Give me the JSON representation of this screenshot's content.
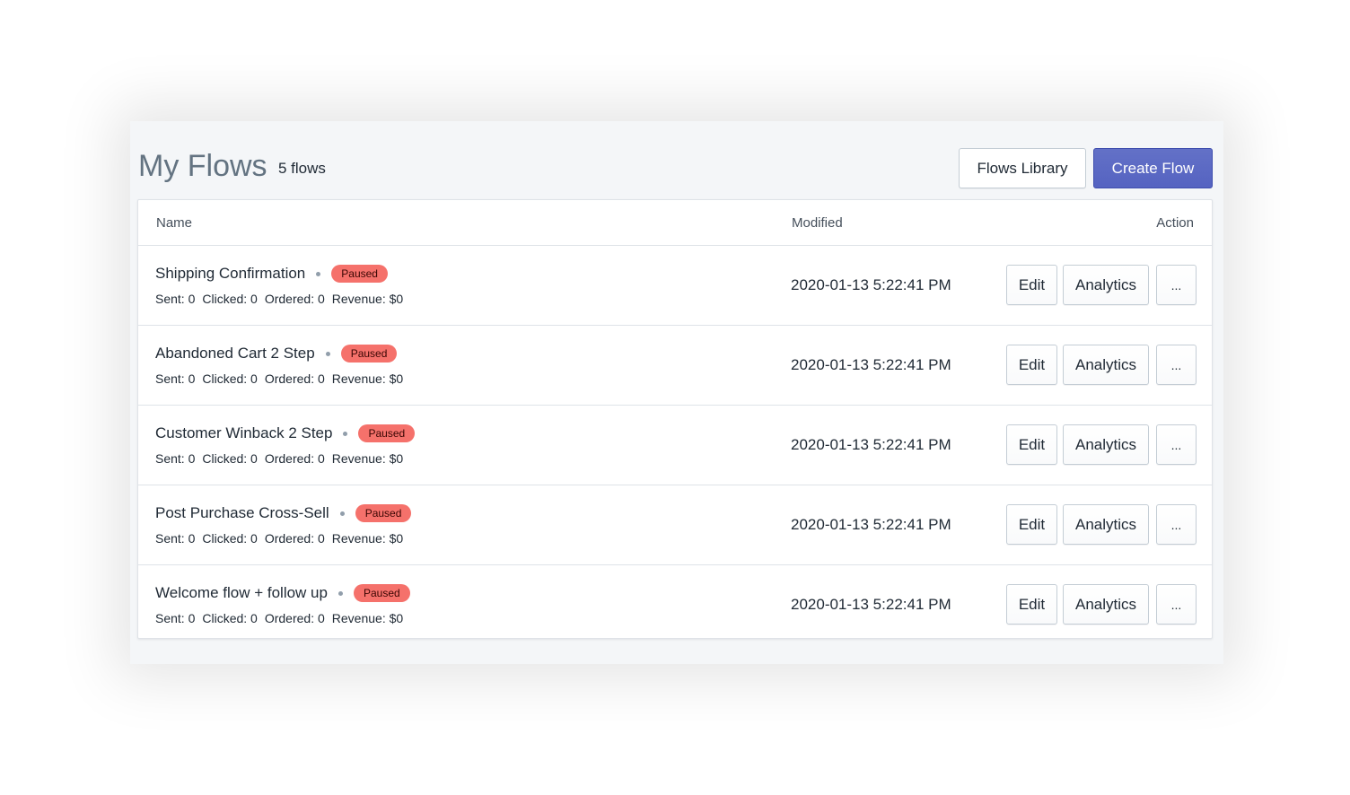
{
  "header": {
    "title": "My Flows",
    "count": "5 flows",
    "library_label": "Flows Library",
    "create_label": "Create Flow"
  },
  "table": {
    "columns": {
      "name": "Name",
      "modified": "Modified",
      "action": "Action"
    },
    "rows": [
      {
        "name": "Shipping Confirmation",
        "status": "Paused",
        "sent": "Sent: 0",
        "clicked": "Clicked: 0",
        "ordered": "Ordered: 0",
        "revenue": "Revenue: $0",
        "modified": "2020-01-13 5:22:41 PM",
        "edit": "Edit",
        "analytics": "Analytics",
        "more": "..."
      },
      {
        "name": "Abandoned Cart 2 Step",
        "status": "Paused",
        "sent": "Sent: 0",
        "clicked": "Clicked: 0",
        "ordered": "Ordered: 0",
        "revenue": "Revenue: $0",
        "modified": "2020-01-13 5:22:41 PM",
        "edit": "Edit",
        "analytics": "Analytics",
        "more": "..."
      },
      {
        "name": "Customer Winback 2 Step",
        "status": "Paused",
        "sent": "Sent: 0",
        "clicked": "Clicked: 0",
        "ordered": "Ordered: 0",
        "revenue": "Revenue: $0",
        "modified": "2020-01-13 5:22:41 PM",
        "edit": "Edit",
        "analytics": "Analytics",
        "more": "..."
      },
      {
        "name": "Post Purchase Cross-Sell",
        "status": "Paused",
        "sent": "Sent: 0",
        "clicked": "Clicked: 0",
        "ordered": "Ordered: 0",
        "revenue": "Revenue: $0",
        "modified": "2020-01-13 5:22:41 PM",
        "edit": "Edit",
        "analytics": "Analytics",
        "more": "..."
      },
      {
        "name": "Welcome flow + follow up",
        "status": "Paused",
        "sent": "Sent: 0",
        "clicked": "Clicked: 0",
        "ordered": "Ordered: 0",
        "revenue": "Revenue: $0",
        "modified": "2020-01-13 5:22:41 PM",
        "edit": "Edit",
        "analytics": "Analytics",
        "more": "..."
      }
    ]
  },
  "colors": {
    "primary": "#5c6ac4",
    "paused_badge": "#f5716b",
    "panel_bg": "#f4f6f8"
  }
}
